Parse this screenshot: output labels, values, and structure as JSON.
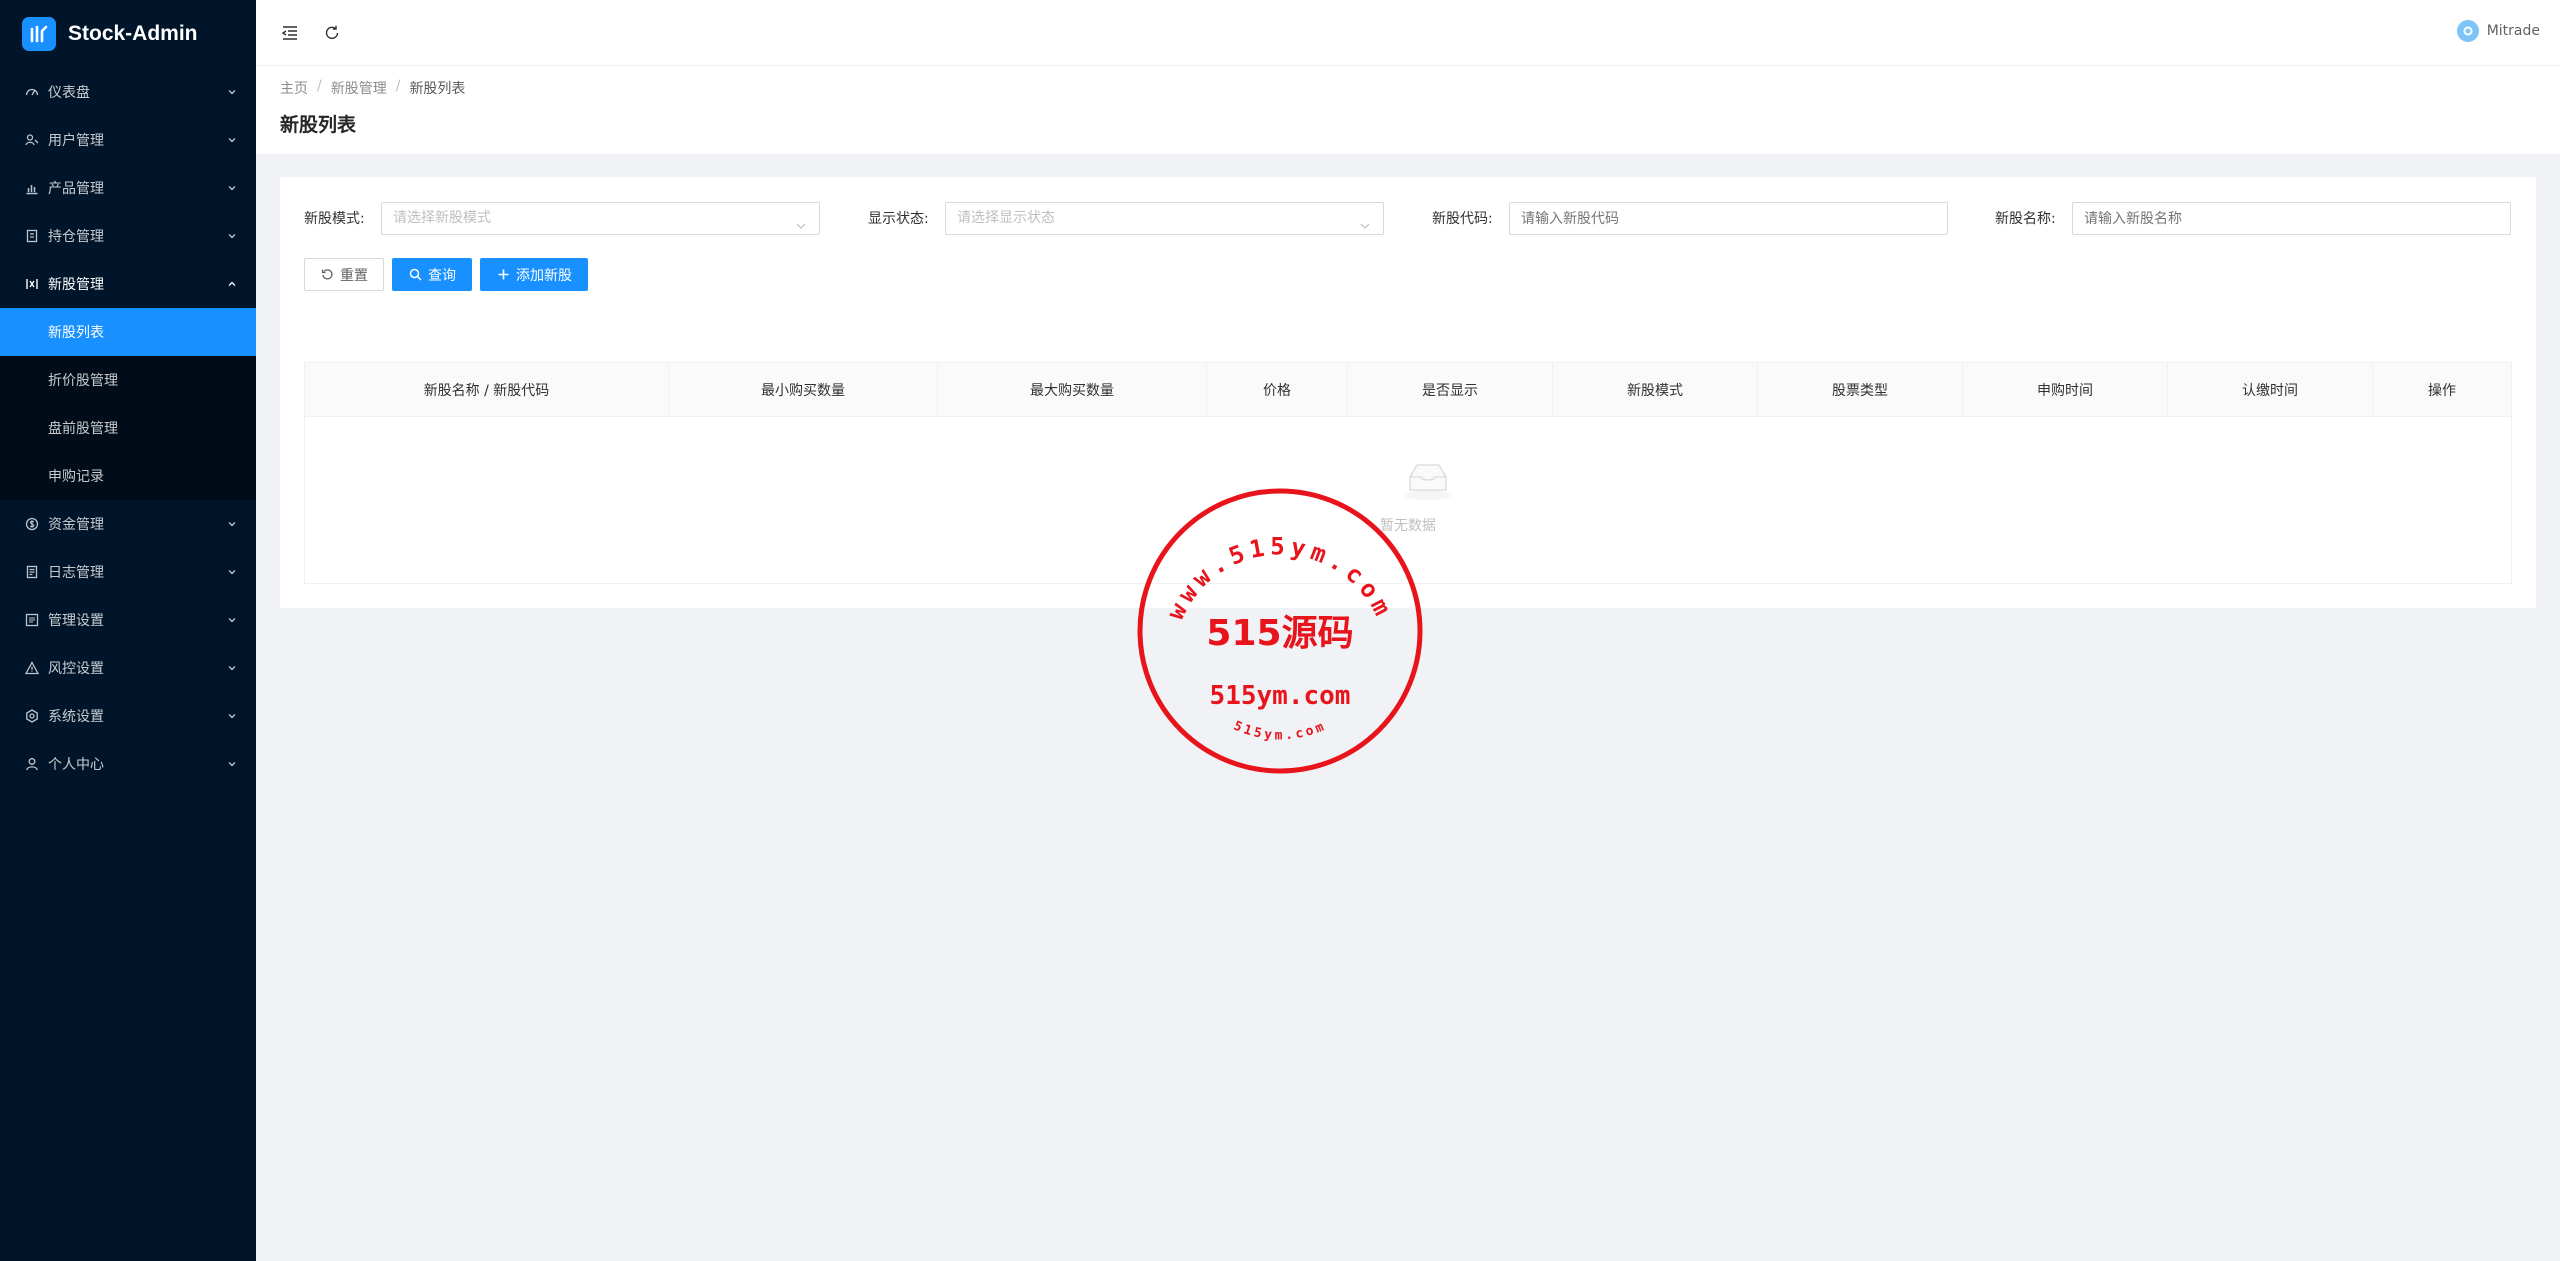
{
  "app": {
    "title": "Stock-Admin"
  },
  "sidebar": {
    "items": [
      {
        "label": "仪表盘",
        "icon": "dashboard-icon",
        "expanded": false
      },
      {
        "label": "用户管理",
        "icon": "users-icon",
        "expanded": false
      },
      {
        "label": "产品管理",
        "icon": "chart-icon",
        "expanded": false
      },
      {
        "label": "持仓管理",
        "icon": "position-icon",
        "expanded": false
      },
      {
        "label": "新股管理",
        "icon": "ipo-icon",
        "expanded": true,
        "children": [
          {
            "label": "新股列表",
            "active": true
          },
          {
            "label": "折价股管理",
            "active": false
          },
          {
            "label": "盘前股管理",
            "active": false
          },
          {
            "label": "申购记录",
            "active": false
          }
        ]
      },
      {
        "label": "资金管理",
        "icon": "funds-icon",
        "expanded": false
      },
      {
        "label": "日志管理",
        "icon": "log-icon",
        "expanded": false
      },
      {
        "label": "管理设置",
        "icon": "admin-settings-icon",
        "expanded": false
      },
      {
        "label": "风控设置",
        "icon": "warning-icon",
        "expanded": false
      },
      {
        "label": "系统设置",
        "icon": "gear-icon",
        "expanded": false
      },
      {
        "label": "个人中心",
        "icon": "user-icon",
        "expanded": false
      }
    ]
  },
  "header": {
    "username": "Mitrade"
  },
  "breadcrumb": [
    "主页",
    "新股管理",
    "新股列表"
  ],
  "page": {
    "title": "新股列表"
  },
  "filters": {
    "mode": {
      "label": "新股模式:",
      "placeholder": "请选择新股模式"
    },
    "status": {
      "label": "显示状态:",
      "placeholder": "请选择显示状态"
    },
    "code": {
      "label": "新股代码:",
      "placeholder": "请输入新股代码"
    },
    "name": {
      "label": "新股名称:",
      "placeholder": "请输入新股名称"
    }
  },
  "buttons": {
    "reset": "重置",
    "search": "查询",
    "add": "添加新股"
  },
  "table": {
    "columns": [
      "新股名称 / 新股代码",
      "最小购买数量",
      "最大购买数量",
      "价格",
      "是否显示",
      "新股模式",
      "股票类型",
      "申购时间",
      "认缴时间",
      "操作"
    ],
    "empty_text": "暂无数据"
  },
  "watermark": {
    "arc_text": "www.515ym.com",
    "main": "515源码",
    "sub": "515ym.com",
    "bottom": "515ym.com"
  },
  "colors": {
    "sidebar_bg": "#001529",
    "submenu_bg": "#000c17",
    "primary": "#1890ff",
    "stamp": "#e8141b"
  }
}
